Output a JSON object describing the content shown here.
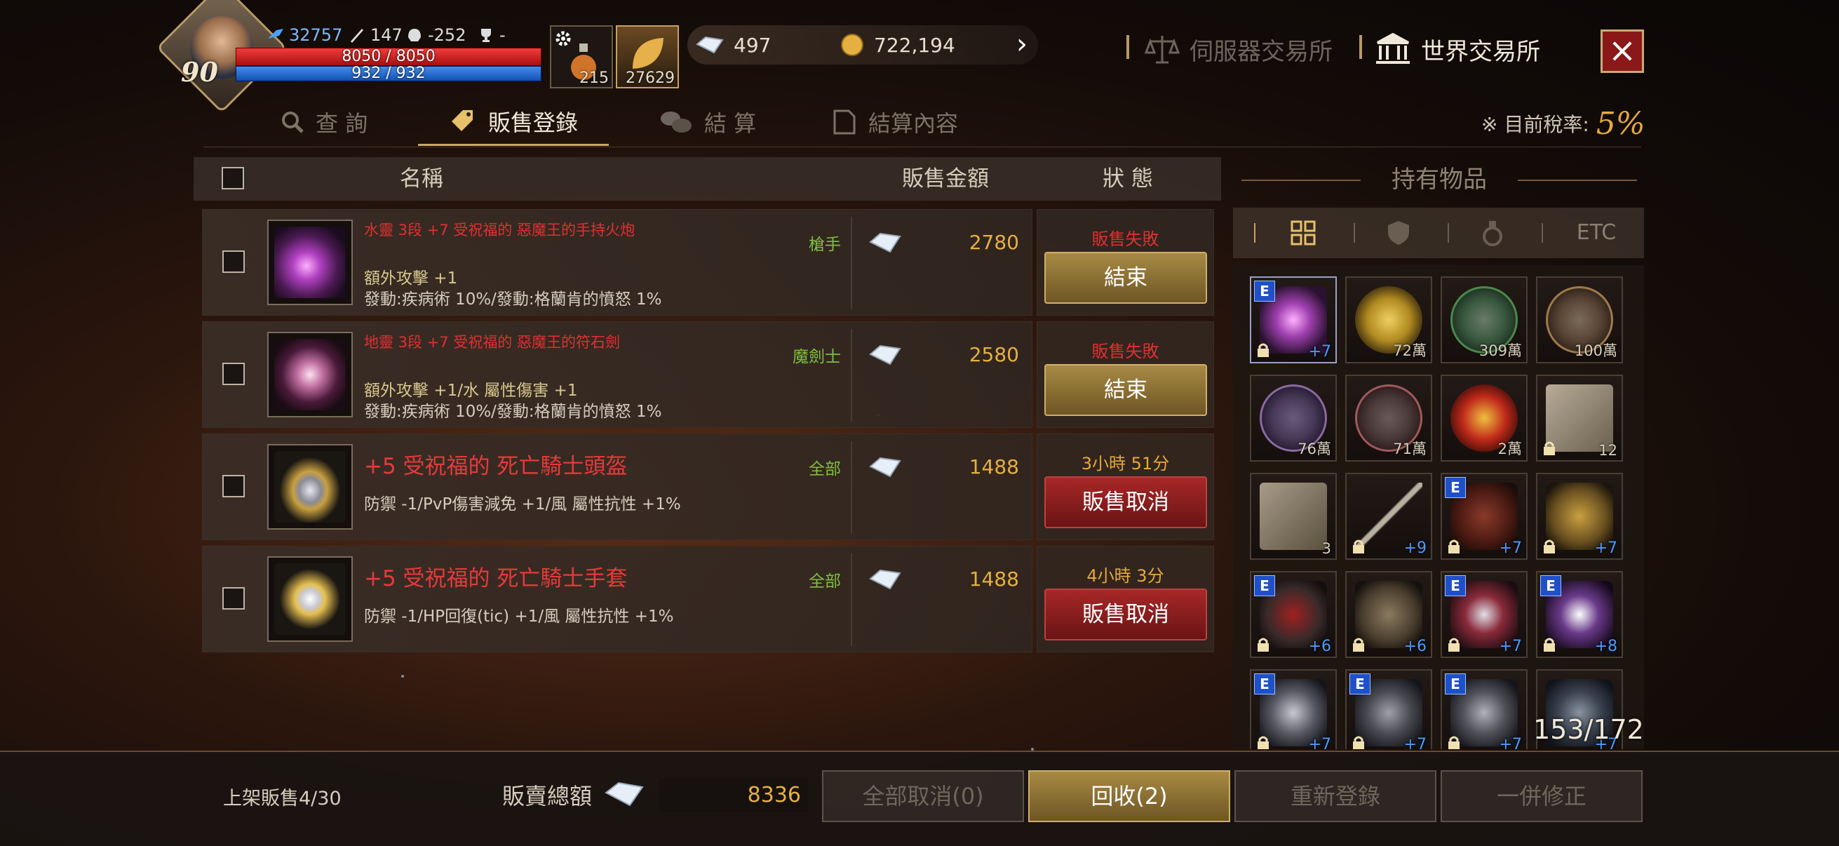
{
  "player": {
    "level": "90",
    "power": "32757",
    "attack": "147",
    "defense": "-252",
    "trophy": "-",
    "hp_text": "8050 / 8050",
    "mp_text": "932 / 932",
    "potion_count": "215",
    "leaf_count": "27629"
  },
  "currency": {
    "diamonds": "497",
    "gold": "722,194"
  },
  "exchange": {
    "server_label": "伺服器交易所",
    "world_label": "世界交易所"
  },
  "tabs": [
    {
      "label": "查 詢"
    },
    {
      "label": "販售登錄"
    },
    {
      "label": "結 算"
    },
    {
      "label": "結算內容"
    }
  ],
  "tax": {
    "label": "※ 目前稅率:",
    "rate": "5%"
  },
  "list_header": {
    "name": "名稱",
    "price": "販售金額",
    "status": "狀 態"
  },
  "listings": [
    {
      "name": "水靈 3段 +7 受祝福的 惡魔王的手持火炮",
      "class": "槍手",
      "line1": "額外攻擊 +1",
      "line2": "發動:疾病術 10%/發動:格蘭肯的憤怒 1%",
      "price": "2780",
      "status": "販售失敗",
      "button": "結束"
    },
    {
      "name": "地靈 3段 +7 受祝福的 惡魔王的符石劍",
      "class": "魔劍士",
      "line1": "額外攻擊 +1/水 屬性傷害 +1",
      "line2": "發動:疾病術 10%/發動:格蘭肯的憤怒 1%",
      "price": "2580",
      "status": "販售失敗",
      "button": "結束"
    },
    {
      "name": "+5 受祝福的 死亡騎士頭盔",
      "class": "全部",
      "line1": "防禦 -1/PvP傷害減免 +1/風 屬性抗性 +1%",
      "price": "1488",
      "status": "3小時 51分",
      "button": "販售取消"
    },
    {
      "name": "+5 受祝福的 死亡騎士手套",
      "class": "全部",
      "line1": "防禦 -1/HP回復(tic) +1/風 屬性抗性 +1%",
      "price": "1488",
      "status": "4小時 3分",
      "button": "販售取消"
    }
  ],
  "inventory": {
    "title": "持有物品",
    "filter_etc": "ETC",
    "count": "153/172",
    "slots": [
      {
        "label": "+7",
        "e": "E"
      },
      {
        "label": "72萬"
      },
      {
        "label": "309萬"
      },
      {
        "label": "100萬"
      },
      {
        "label": "76萬"
      },
      {
        "label": "71萬"
      },
      {
        "label": "2萬"
      },
      {
        "label": "12"
      },
      {
        "label": "3"
      },
      {
        "label": "+9"
      },
      {
        "label": "+7",
        "e": "E"
      },
      {
        "label": "+7"
      },
      {
        "label": "+6",
        "e": "E"
      },
      {
        "label": "+6"
      },
      {
        "label": "+7",
        "e": "E"
      },
      {
        "label": "+8",
        "e": "E"
      },
      {
        "label": "+7",
        "e": "E"
      },
      {
        "label": "+7",
        "e": "E"
      },
      {
        "label": "+7",
        "e": "E"
      },
      {
        "label": "+7"
      }
    ]
  },
  "bottom": {
    "listing_count": "上架販售4/30",
    "total_label": "販賣總額",
    "total_value": "8336",
    "btn_cancel_all": "全部取消(0)",
    "btn_collect": "回收(2)",
    "btn_relist": "重新登錄",
    "btn_fix": "一併修正"
  }
}
